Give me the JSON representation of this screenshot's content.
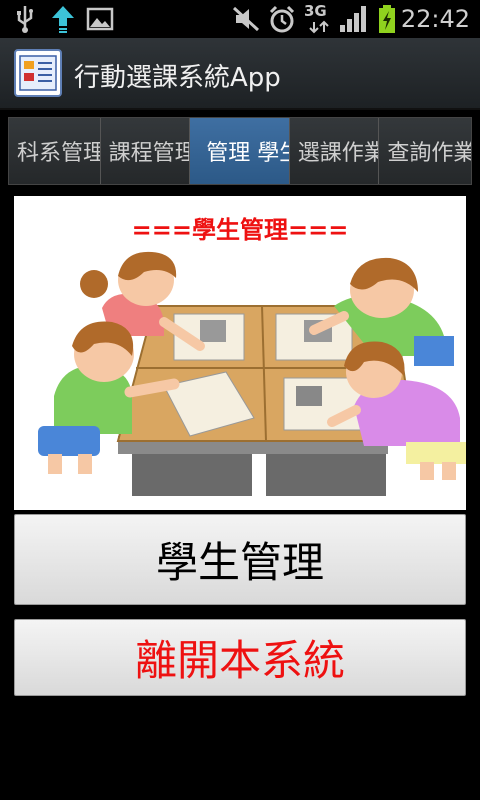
{
  "status_bar": {
    "time": "22:42",
    "network_label": "3G",
    "icons": [
      "usb-icon",
      "upload-icon",
      "image-icon",
      "mute-icon",
      "alarm-icon",
      "signal-icon",
      "battery-charging-icon"
    ]
  },
  "app": {
    "title": "行動選課系統App"
  },
  "tabs": [
    {
      "label": "科系管理",
      "selected": false
    },
    {
      "label": "課程管理",
      "selected": false
    },
    {
      "label": "管理 學生",
      "selected": true
    },
    {
      "label": "選課作業",
      "selected": false
    },
    {
      "label": "查詢作業",
      "selected": false
    }
  ],
  "main": {
    "illustration_title": "===學生管理===",
    "student_button_label": "學生管理",
    "exit_button_label": "離開本系統"
  },
  "colors": {
    "accent_red": "#ee1111",
    "tab_selected": "#3f6fa2"
  }
}
